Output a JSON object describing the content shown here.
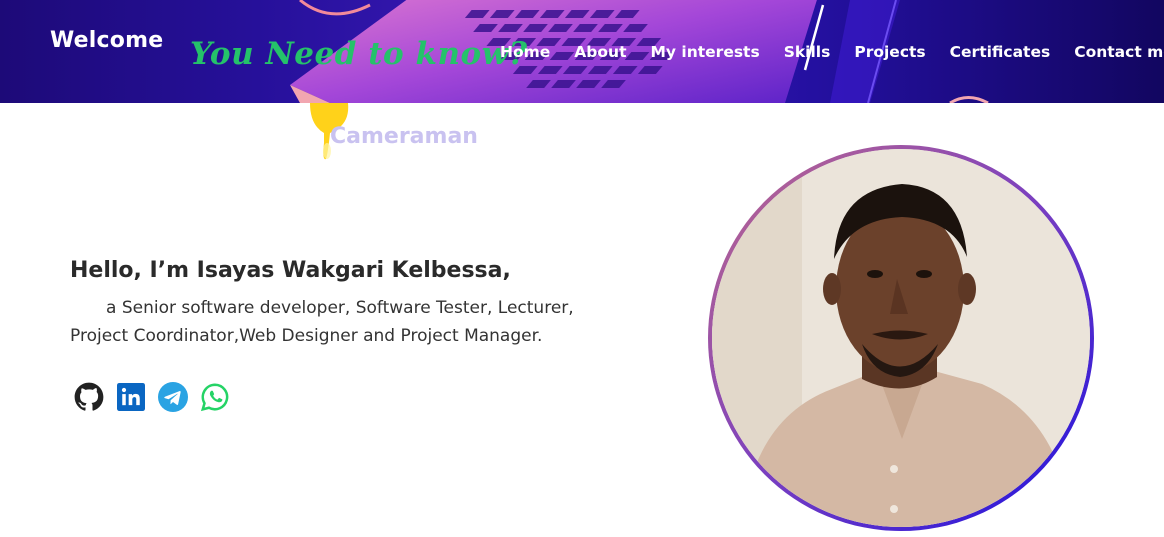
{
  "header": {
    "brand": "Welcome",
    "tagline": "You Need to know?",
    "nav": [
      "Home",
      "About",
      "My interests",
      "Skills",
      "Projects",
      "Certificates",
      "Contact me"
    ]
  },
  "hero": {
    "rotating_text": "Cameraman",
    "greeting": "Hello, I’m Isayas Wakgari Kelbessa,",
    "description": "a Senior software developer, Software Tester, Lecturer, Project Coordinator,Web Designer and Project Manager.",
    "socials": [
      {
        "name": "github-icon",
        "color": "#222222"
      },
      {
        "name": "linkedin-icon",
        "color": "#0a66c2"
      },
      {
        "name": "telegram-icon",
        "color": "#2aa3e3"
      },
      {
        "name": "whatsapp-icon",
        "color": "#25d366"
      }
    ]
  },
  "colors": {
    "header_bg": "#26109a",
    "tagline": "#25c26a",
    "ring_start": "#c06a8a",
    "ring_end": "#1a0fe0"
  }
}
